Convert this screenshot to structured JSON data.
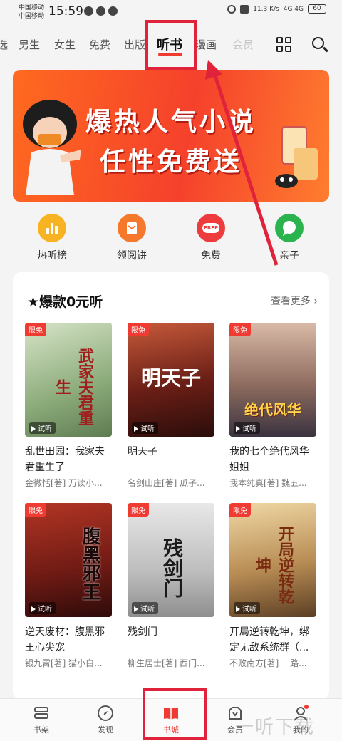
{
  "status_bar": {
    "carrier_1": "中国移动",
    "carrier_2": "中国移动",
    "time": "15:59",
    "speed": "11.3 K/s",
    "network": "4G 4G",
    "battery": "60"
  },
  "top_nav": {
    "tabs": [
      {
        "label": "选"
      },
      {
        "label": "男生"
      },
      {
        "label": "女生"
      },
      {
        "label": "免费"
      },
      {
        "label": "出版"
      },
      {
        "label": "听书"
      },
      {
        "label": "漫画"
      },
      {
        "label": "会员"
      }
    ],
    "active_tab": "听书"
  },
  "banner": {
    "line1": "爆热人气小说",
    "line2": "任性免费送"
  },
  "quick_links": [
    {
      "label": "热听榜",
      "icon": "chart-icon",
      "color": "#f7b321"
    },
    {
      "label": "领阅饼",
      "icon": "mail-icon",
      "color": "#f5782c"
    },
    {
      "label": "免费",
      "icon": "free-icon",
      "color": "#ee3b3b",
      "icon_text": "FREE"
    },
    {
      "label": "亲子",
      "icon": "chat-icon",
      "color": "#2bb34d"
    }
  ],
  "section": {
    "title": "★爆款0元听",
    "see_more": "查看更多",
    "badge": "限免",
    "listen_label": "试听",
    "books": [
      {
        "title": "乱世田园：我家夫君重生了",
        "author": "金微恬[著] 万读小...",
        "cover_title": "武家夫君重生"
      },
      {
        "title": "明天子",
        "author": "名剑山庄[著] 瓜子...",
        "cover_title": "明天子"
      },
      {
        "title": "我的七个绝代风华姐姐",
        "author": "我本纯真[著] 魏五...",
        "cover_title": "绝代风华"
      },
      {
        "title": "逆天废材：腹黑邪王心尖宠",
        "author": "银九霄[著] 猫小白...",
        "cover_title": "腹黑邪王"
      },
      {
        "title": "残剑门",
        "author": "柳生居士[著] 西门...",
        "cover_title": "残剑门"
      },
      {
        "title": "开局逆转乾坤，绑定无敌系统群（...",
        "author": "不败南方[著] 一路...",
        "cover_title": "开局逆转乾坤"
      }
    ]
  },
  "bottom_nav": {
    "items": [
      {
        "label": "书架",
        "icon": "bookshelf-icon"
      },
      {
        "label": "发现",
        "icon": "compass-icon"
      },
      {
        "label": "书城",
        "icon": "book-icon"
      },
      {
        "label": "会员",
        "icon": "vip-icon"
      },
      {
        "label": "我的",
        "icon": "profile-icon"
      }
    ],
    "active": "书城"
  },
  "watermark": "一听下载",
  "colors": {
    "accent": "#ef3b32",
    "annotation": "#e0233a"
  }
}
